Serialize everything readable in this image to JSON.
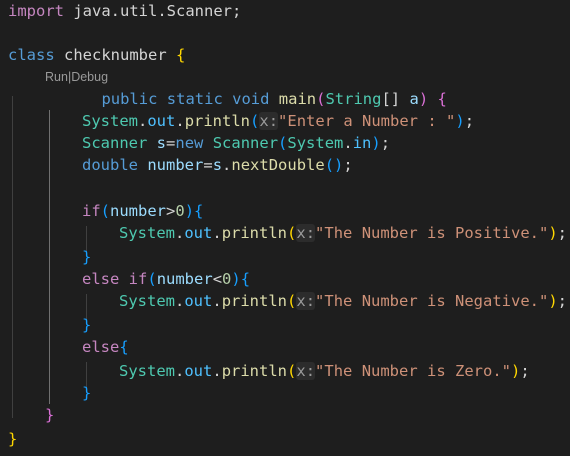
{
  "editor": {
    "background": "#1e1e1e",
    "codelens": {
      "run": "Run",
      "separator": "|",
      "debug": "Debug"
    },
    "tokens": {
      "import": "import",
      "import_path": "java.util.Scanner",
      "semicolon": ";",
      "class": "class",
      "class_name": "checknumber",
      "public": "public",
      "static": "static",
      "void": "void",
      "main": "main",
      "String": "String",
      "brackets": "[]",
      "param": "a",
      "System": "System",
      "out": "out",
      "in": "in",
      "println": "println",
      "hint_x": "x:",
      "Scanner": "Scanner",
      "s": "s",
      "new": "new",
      "double": "double",
      "number": "number",
      "nextDouble": "nextDouble",
      "if": "if",
      "else": "else",
      "zero": "0",
      "gt": ">",
      "lt": "<",
      "eq": "=",
      "dot": ".",
      "lparen": "(",
      "rparen": ")",
      "lbrace": "{",
      "rbrace": "}",
      "space": " "
    },
    "strings": {
      "prompt": "\"Enter a Number : \"",
      "positive": "\"The Number is Positive.\"",
      "negative": "\"The Number is Negative.\"",
      "zero": "\"The Number is Zero.\""
    }
  }
}
